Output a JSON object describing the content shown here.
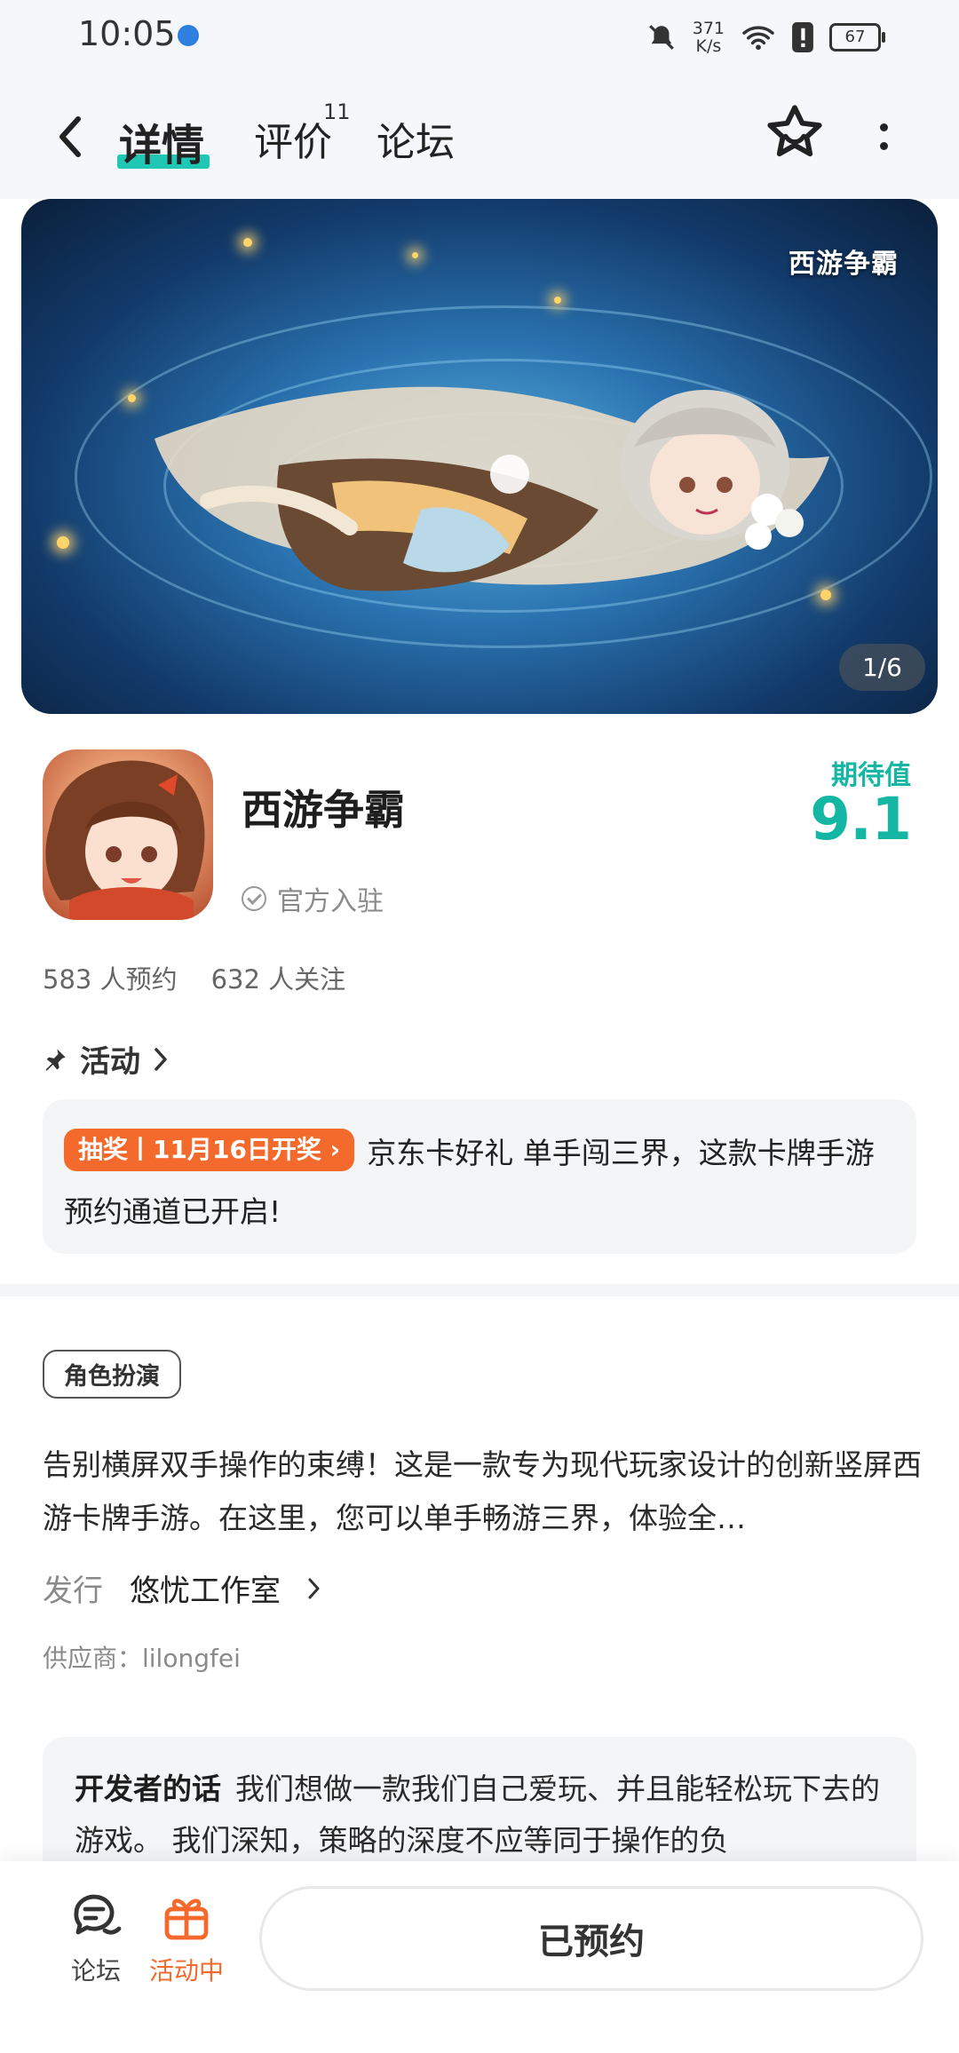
{
  "status_bar": {
    "time": "10:05",
    "speed_value": "371",
    "speed_unit": "K/s",
    "battery": "67"
  },
  "header": {
    "tabs": [
      {
        "label": "详情"
      },
      {
        "label": "评价",
        "badge": "11"
      },
      {
        "label": "论坛"
      }
    ]
  },
  "banner": {
    "logo_text": "西游争霸",
    "counter": "1/6"
  },
  "app": {
    "title": "西游争霸",
    "official": "官方入驻",
    "expect_label": "期待值",
    "expect_score": "9.1",
    "reservations": "583 人预约",
    "followers": "632 人关注"
  },
  "activity": {
    "heading": "活动",
    "tag": "抽奖丨11月16日开奖",
    "text": "京东卡好礼 单手闯三界，这款卡牌手游预约通道已开启!"
  },
  "details": {
    "genre": "角色扮演",
    "description": "告别横屏双手操作的束缚！这是一款专为现代玩家设计的创新竖屏西游卡牌手游。在这里，您可以单手畅游三界，体验全…",
    "publisher_label": "发行",
    "publisher": "悠忧工作室",
    "supplier": "供应商：lilongfei"
  },
  "developer": {
    "label": "开发者的话",
    "text": "我们想做一款我们自己爱玩、并且能轻松玩下去的游戏。 我们深知，策略的深度不应等同于操作的负"
  },
  "bottom_bar": {
    "forum_label": "论坛",
    "activity_label": "活动中",
    "reserved_label": "已预约"
  },
  "colors": {
    "accent_teal": "#15b7a4",
    "accent_orange": "#f36a2c"
  }
}
